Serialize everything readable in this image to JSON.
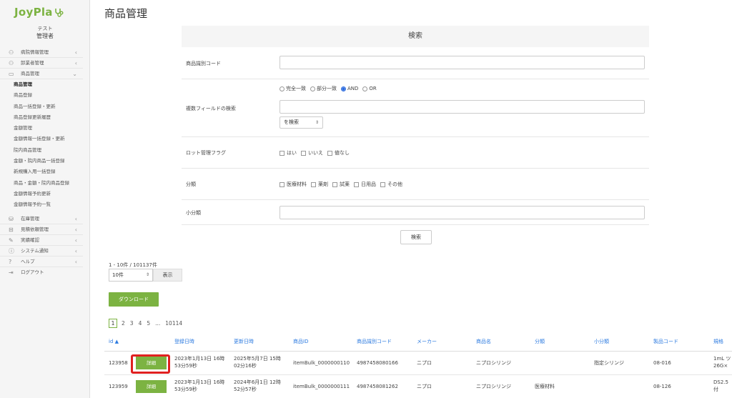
{
  "app": {
    "logo_text": "JoyPla",
    "user_org": "テスト",
    "user_role": "管理者"
  },
  "sidebar": {
    "groups_top": [
      {
        "label": "病院情報管理",
        "icon": "hospital-user-icon"
      },
      {
        "label": "卸業者管理",
        "icon": "users-icon"
      },
      {
        "label": "商品管理",
        "icon": "folder-icon",
        "expanded": true
      }
    ],
    "sub_items": [
      {
        "label": "商品管理",
        "active": true
      },
      {
        "label": "商品登録"
      },
      {
        "label": "商品一括登録・更新"
      },
      {
        "label": "商品登録更新履歴"
      },
      {
        "label": "金額管理"
      },
      {
        "label": "金額情報一括登録・更新"
      },
      {
        "label": "院内商品管理"
      },
      {
        "label": "金額・院内商品一括登録"
      },
      {
        "label": "新規購入用一括登録"
      },
      {
        "label": "商品・金額・院内商品登録"
      },
      {
        "label": "金額情報予約更新"
      },
      {
        "label": "金額情報予約一覧"
      }
    ],
    "groups_bottom": [
      {
        "label": "在庫管理",
        "icon": "database-icon"
      },
      {
        "label": "見積依頼管理",
        "icon": "inbox-icon"
      },
      {
        "label": "実績確認",
        "icon": "edit-icon"
      },
      {
        "label": "システム通知",
        "icon": "info-icon"
      },
      {
        "label": "ヘルプ",
        "icon": "question-icon"
      },
      {
        "label": "ログアウト",
        "icon": "logout-icon"
      }
    ]
  },
  "page": {
    "title": "商品管理"
  },
  "search": {
    "header": "検索",
    "code_label": "商品識別コード",
    "multi_label": "複数フィールドの検索",
    "match_options": [
      "完全一致",
      "部分一致",
      "AND",
      "OR"
    ],
    "match_selected": "AND",
    "field_select": "を検索",
    "lot_label": "ロット管理フラグ",
    "lot_options": [
      "はい",
      "いいえ",
      "値なし"
    ],
    "category_label": "分類",
    "category_options": [
      "医療材料",
      "薬剤",
      "試薬",
      "日用品",
      "その他"
    ],
    "subcategory_label": "小分類",
    "button": "検索"
  },
  "results": {
    "count_text": "1 - 10件 / 101137件",
    "per_page": "10件",
    "show_button": "表示",
    "download_button": "ダウンロード",
    "pages": [
      "1",
      "2",
      "3",
      "4",
      "5",
      "...",
      "10114"
    ],
    "current_page": "1"
  },
  "table": {
    "headers": [
      "id ▲",
      "登録日時",
      "更新日時",
      "商品ID",
      "商品識別コード",
      "メーカー",
      "商品名",
      "分類",
      "小分類",
      "製品コード",
      "規格"
    ],
    "detail_label": "詳細",
    "rows": [
      {
        "id": "123958",
        "created_1": "2023年1月13日 16時",
        "created_2": "53分59秒",
        "updated_1": "2025年5月7日 15時",
        "updated_2": "02分16秒",
        "item_id": "itemBulk_0000000110",
        "code": "4987458080166",
        "maker": "ニプロ",
        "name": "ニプロシリンジ",
        "category": "",
        "subcategory": "指定シリンジ",
        "product_code": "08-016",
        "spec_1": "1mL ツ",
        "spec_2": "26G×"
      },
      {
        "id": "123959",
        "created_1": "2023年1月13日 16時",
        "created_2": "53分59秒",
        "updated_1": "2024年6月1日 12時",
        "updated_2": "52分57秒",
        "item_id": "itemBulk_0000000111",
        "code": "4987458081262",
        "maker": "ニプロ",
        "name": "ニプロシリンジ",
        "category": "医療材料",
        "subcategory": "",
        "product_code": "08-126",
        "spec_1": "DS2.5",
        "spec_2": "付"
      }
    ]
  },
  "colors": {
    "accent": "#7cb342",
    "link": "#2d7be0",
    "highlight": "#e02020"
  }
}
